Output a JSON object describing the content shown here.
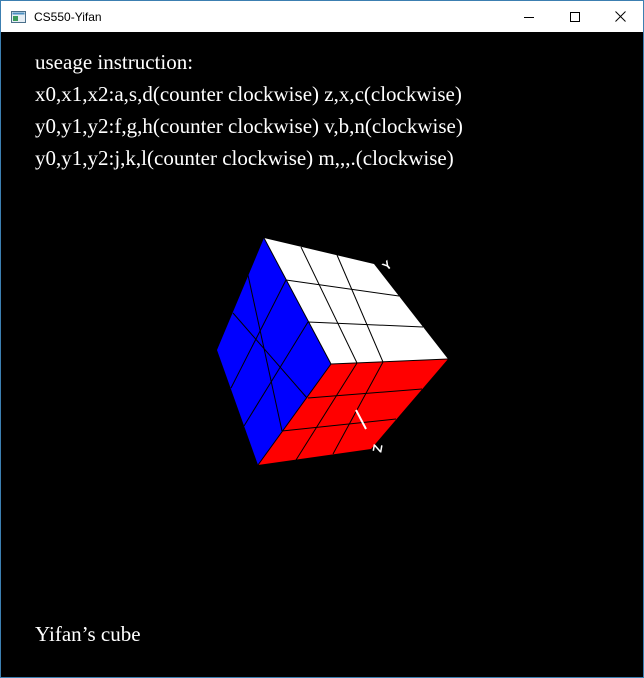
{
  "window": {
    "title": "CS550-Yifan",
    "icon": "app-window-icon",
    "controls": {
      "minimize_icon": "minimize-icon",
      "maximize_icon": "maximize-icon",
      "close_icon": "close-icon"
    }
  },
  "instructions": {
    "heading": "useage instruction:",
    "lines": [
      "x0,x1,x2:a,s,d(counter clockwise) z,x,c(clockwise)",
      "y0,y1,y2:f,g,h(counter clockwise) v,b,n(clockwise)",
      "y0,y1,y2:j,k,l(counter clockwise) m,,,.(clockwise)"
    ]
  },
  "cube": {
    "faces": {
      "top": "#ffffff",
      "left": "#0000ff",
      "front": "#ff0000"
    },
    "axis_labels": {
      "y": "Y",
      "z": "Z"
    }
  },
  "footer": {
    "caption": "Yifan’s cube"
  }
}
